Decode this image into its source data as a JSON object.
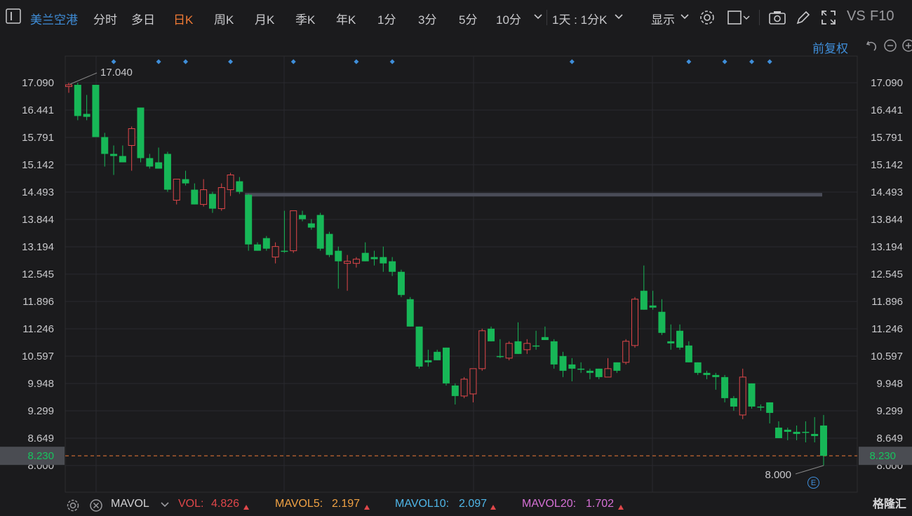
{
  "toolbar": {
    "name": "美兰空港",
    "items": [
      "分时",
      "多日",
      "日K",
      "周K",
      "月K",
      "季K",
      "年K",
      "1分",
      "3分",
      "5分",
      "10分"
    ],
    "active": "日K",
    "period": "1天 : 1分K",
    "display": "显示",
    "vs": "VS",
    "f10": "F10",
    "adjust": "前复权"
  },
  "colors": {
    "up": "#e0474a",
    "down": "#17b757",
    "brand": "#3f8ed9",
    "accent": "#f07a35"
  },
  "chart_data": {
    "type": "candlestick",
    "y_ticks": [
      "17.090",
      "16.441",
      "15.791",
      "15.142",
      "14.493",
      "13.844",
      "13.194",
      "12.545",
      "11.896",
      "11.246",
      "10.597",
      "9.948",
      "9.299",
      "8.649",
      "8.000"
    ],
    "ylim": [
      8.0,
      17.09
    ],
    "current_price": "8.230",
    "max_label": "17.040",
    "min_label": "8.000",
    "resistance_level": 14.43,
    "candles": [
      {
        "o": 17.0,
        "h": 17.09,
        "l": 16.85,
        "c": 17.04
      },
      {
        "o": 17.04,
        "h": 17.09,
        "l": 16.2,
        "c": 16.3
      },
      {
        "o": 16.35,
        "h": 16.8,
        "l": 16.2,
        "c": 16.28
      },
      {
        "o": 17.04,
        "h": 17.04,
        "l": 15.8,
        "c": 15.8
      },
      {
        "o": 15.8,
        "h": 15.9,
        "l": 15.1,
        "c": 15.4
      },
      {
        "o": 15.4,
        "h": 15.6,
        "l": 14.9,
        "c": 15.35
      },
      {
        "o": 15.35,
        "h": 15.6,
        "l": 15.2,
        "c": 15.2
      },
      {
        "o": 15.6,
        "h": 16.05,
        "l": 15.0,
        "c": 16.0
      },
      {
        "o": 16.5,
        "h": 16.5,
        "l": 15.2,
        "c": 15.3
      },
      {
        "o": 15.3,
        "h": 15.4,
        "l": 15.05,
        "c": 15.1
      },
      {
        "o": 15.2,
        "h": 15.55,
        "l": 15.05,
        "c": 15.05
      },
      {
        "o": 15.4,
        "h": 15.45,
        "l": 14.5,
        "c": 14.55
      },
      {
        "o": 14.3,
        "h": 14.8,
        "l": 14.2,
        "c": 14.8
      },
      {
        "o": 14.8,
        "h": 15.0,
        "l": 14.65,
        "c": 14.7
      },
      {
        "o": 14.55,
        "h": 14.7,
        "l": 14.2,
        "c": 14.2
      },
      {
        "o": 14.2,
        "h": 14.8,
        "l": 14.15,
        "c": 14.55
      },
      {
        "o": 14.45,
        "h": 14.5,
        "l": 14.0,
        "c": 14.1
      },
      {
        "o": 14.1,
        "h": 14.7,
        "l": 14.05,
        "c": 14.6
      },
      {
        "o": 14.55,
        "h": 14.95,
        "l": 14.4,
        "c": 14.9
      },
      {
        "o": 14.75,
        "h": 14.85,
        "l": 14.45,
        "c": 14.5
      },
      {
        "o": 14.43,
        "h": 14.45,
        "l": 13.1,
        "c": 13.25
      },
      {
        "o": 13.25,
        "h": 13.3,
        "l": 13.1,
        "c": 13.1
      },
      {
        "o": 13.4,
        "h": 13.45,
        "l": 13.1,
        "c": 13.15
      },
      {
        "o": 12.95,
        "h": 13.3,
        "l": 12.8,
        "c": 13.2
      },
      {
        "o": 13.1,
        "h": 14.05,
        "l": 13.05,
        "c": 13.1
      },
      {
        "o": 13.1,
        "h": 14.05,
        "l": 13.05,
        "c": 14.05
      },
      {
        "o": 13.95,
        "h": 14.05,
        "l": 13.8,
        "c": 13.85
      },
      {
        "o": 13.75,
        "h": 13.85,
        "l": 13.6,
        "c": 13.65
      },
      {
        "o": 13.95,
        "h": 14.0,
        "l": 13.1,
        "c": 13.15
      },
      {
        "o": 13.5,
        "h": 13.55,
        "l": 12.95,
        "c": 13.0
      },
      {
        "o": 13.1,
        "h": 13.2,
        "l": 12.2,
        "c": 12.85
      },
      {
        "o": 12.8,
        "h": 13.0,
        "l": 12.15,
        "c": 12.85
      },
      {
        "o": 12.8,
        "h": 12.95,
        "l": 12.7,
        "c": 12.9
      },
      {
        "o": 13.05,
        "h": 13.3,
        "l": 12.85,
        "c": 12.85
      },
      {
        "o": 12.95,
        "h": 13.1,
        "l": 12.75,
        "c": 12.9
      },
      {
        "o": 12.95,
        "h": 13.2,
        "l": 12.6,
        "c": 12.8
      },
      {
        "o": 12.85,
        "h": 12.95,
        "l": 12.5,
        "c": 12.6
      },
      {
        "o": 12.6,
        "h": 12.65,
        "l": 12.0,
        "c": 12.05
      },
      {
        "o": 11.95,
        "h": 12.0,
        "l": 11.3,
        "c": 11.3
      },
      {
        "o": 11.3,
        "h": 11.3,
        "l": 10.3,
        "c": 10.35
      },
      {
        "o": 10.5,
        "h": 10.75,
        "l": 10.35,
        "c": 10.45
      },
      {
        "o": 10.7,
        "h": 10.75,
        "l": 10.5,
        "c": 10.5
      },
      {
        "o": 10.8,
        "h": 10.8,
        "l": 9.9,
        "c": 9.95
      },
      {
        "o": 9.9,
        "h": 9.95,
        "l": 9.45,
        "c": 9.65
      },
      {
        "o": 9.65,
        "h": 10.1,
        "l": 9.6,
        "c": 10.05
      },
      {
        "o": 9.7,
        "h": 10.3,
        "l": 9.5,
        "c": 10.3
      },
      {
        "o": 10.3,
        "h": 11.25,
        "l": 10.25,
        "c": 11.2
      },
      {
        "o": 11.25,
        "h": 11.3,
        "l": 10.95,
        "c": 10.95
      },
      {
        "o": 10.6,
        "h": 11.0,
        "l": 10.55,
        "c": 10.6
      },
      {
        "o": 10.55,
        "h": 10.95,
        "l": 10.5,
        "c": 10.9
      },
      {
        "o": 10.95,
        "h": 11.4,
        "l": 10.65,
        "c": 10.65
      },
      {
        "o": 10.75,
        "h": 11.0,
        "l": 10.65,
        "c": 10.9
      },
      {
        "o": 10.85,
        "h": 11.2,
        "l": 10.75,
        "c": 10.85
      },
      {
        "o": 11.05,
        "h": 11.3,
        "l": 11.0,
        "c": 10.98
      },
      {
        "o": 10.95,
        "h": 11.0,
        "l": 10.3,
        "c": 10.4
      },
      {
        "o": 10.6,
        "h": 10.7,
        "l": 10.1,
        "c": 10.25
      },
      {
        "o": 10.4,
        "h": 10.55,
        "l": 10.0,
        "c": 10.3
      },
      {
        "o": 10.3,
        "h": 10.45,
        "l": 10.2,
        "c": 10.3
      },
      {
        "o": 10.25,
        "h": 10.3,
        "l": 10.05,
        "c": 10.2
      },
      {
        "o": 10.3,
        "h": 10.3,
        "l": 10.05,
        "c": 10.1
      },
      {
        "o": 10.1,
        "h": 10.55,
        "l": 10.1,
        "c": 10.3
      },
      {
        "o": 10.45,
        "h": 10.45,
        "l": 10.2,
        "c": 10.25
      },
      {
        "o": 10.45,
        "h": 11.0,
        "l": 10.4,
        "c": 10.95
      },
      {
        "o": 10.85,
        "h": 12.0,
        "l": 10.8,
        "c": 11.95
      },
      {
        "o": 12.15,
        "h": 12.75,
        "l": 11.7,
        "c": 11.7
      },
      {
        "o": 11.8,
        "h": 12.15,
        "l": 11.7,
        "c": 11.75
      },
      {
        "o": 11.65,
        "h": 11.95,
        "l": 11.1,
        "c": 11.15
      },
      {
        "o": 10.95,
        "h": 11.35,
        "l": 10.75,
        "c": 10.9
      },
      {
        "o": 11.2,
        "h": 11.35,
        "l": 10.75,
        "c": 10.8
      },
      {
        "o": 10.85,
        "h": 10.95,
        "l": 10.45,
        "c": 10.45
      },
      {
        "o": 10.45,
        "h": 10.45,
        "l": 10.15,
        "c": 10.2
      },
      {
        "o": 10.2,
        "h": 10.25,
        "l": 10.05,
        "c": 10.15
      },
      {
        "o": 10.15,
        "h": 10.2,
        "l": 9.8,
        "c": 10.1
      },
      {
        "o": 10.1,
        "h": 10.15,
        "l": 9.5,
        "c": 9.6
      },
      {
        "o": 9.6,
        "h": 9.65,
        "l": 9.3,
        "c": 9.4
      },
      {
        "o": 9.2,
        "h": 10.3,
        "l": 9.1,
        "c": 10.1
      },
      {
        "o": 9.95,
        "h": 9.95,
        "l": 9.35,
        "c": 9.4
      },
      {
        "o": 9.4,
        "h": 9.45,
        "l": 9.3,
        "c": 9.4
      },
      {
        "o": 9.5,
        "h": 9.5,
        "l": 9.0,
        "c": 9.25
      },
      {
        "o": 8.9,
        "h": 9.05,
        "l": 8.65,
        "c": 8.65
      },
      {
        "o": 8.85,
        "h": 8.9,
        "l": 8.6,
        "c": 8.8
      },
      {
        "o": 8.8,
        "h": 8.95,
        "l": 8.6,
        "c": 8.75
      },
      {
        "o": 8.8,
        "h": 9.05,
        "l": 8.55,
        "c": 8.8
      },
      {
        "o": 8.75,
        "h": 9.15,
        "l": 8.55,
        "c": 8.7
      },
      {
        "o": 8.95,
        "h": 9.2,
        "l": 8.0,
        "c": 8.23
      }
    ],
    "markers": [
      5,
      10,
      13,
      18,
      25,
      32,
      36,
      56,
      69,
      73,
      76,
      78
    ]
  },
  "volume_bar": {
    "name": "MAVOL",
    "vol_label": "VOL:",
    "vol": "4.826",
    "ma5_label": "MAVOL5:",
    "ma5": "2.197",
    "ma10_label": "MAVOL10:",
    "ma10": "2.097",
    "ma20_label": "MAVOL20:",
    "ma20": "1.702",
    "ma5_color": "#f0a244",
    "ma10_color": "#4fb6e8",
    "ma20_color": "#d670d6",
    "vol_color": "#e0474a"
  },
  "watermark": "格隆汇",
  "e_badge": "E"
}
